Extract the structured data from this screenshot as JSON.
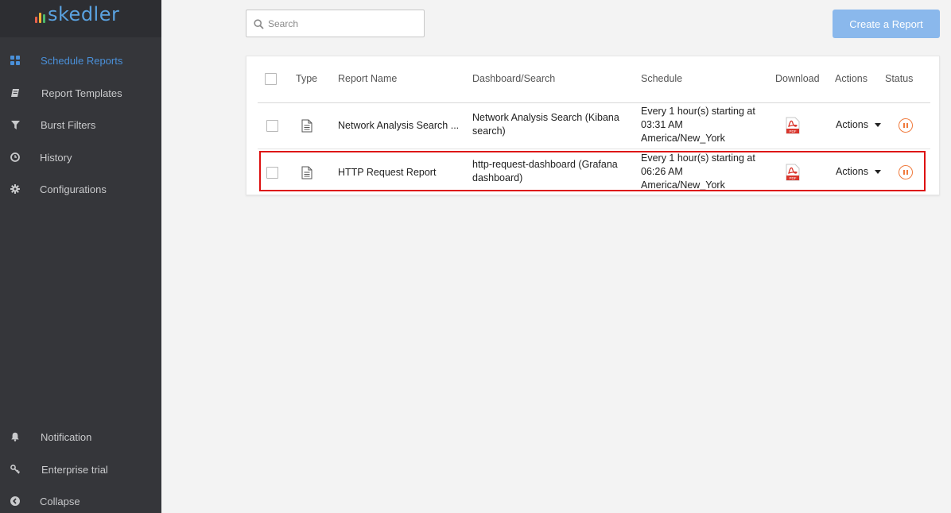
{
  "app": {
    "logo_text": "skedler",
    "logo_bar_colors": [
      "#e8604c",
      "#f2b233",
      "#4cb86b",
      "#4a90d9"
    ]
  },
  "sidebar": {
    "items": [
      {
        "label": "Schedule Reports",
        "icon": "grid-icon",
        "active": true
      },
      {
        "label": "Report Templates",
        "icon": "book-icon"
      },
      {
        "label": "Burst Filters",
        "icon": "filter-icon"
      },
      {
        "label": "History",
        "icon": "clock-icon"
      },
      {
        "label": "Configurations",
        "icon": "gear-icon"
      }
    ],
    "bottom_items": [
      {
        "label": "Notification",
        "icon": "bell-icon"
      },
      {
        "label": "Enterprise trial",
        "icon": "key-icon"
      },
      {
        "label": "Collapse",
        "icon": "chevron-left-circle-icon"
      }
    ]
  },
  "search": {
    "placeholder": "Search",
    "value": ""
  },
  "toolbar": {
    "create_label": "Create a Report"
  },
  "table": {
    "columns": [
      "Type",
      "Report Name",
      "Dashboard/Search",
      "Schedule",
      "Download",
      "Actions",
      "Status"
    ],
    "rows": [
      {
        "type_icon": "document-icon",
        "name": "Network Analysis Search ...",
        "dashboard": "Network Analysis Search (Kibana search)",
        "schedule": "Every 1 hour(s) starting at 03:31 AM America/New_York",
        "download_icon": "pdf-icon",
        "actions_label": "Actions",
        "status_icon": "pause-icon"
      },
      {
        "type_icon": "document-icon",
        "name": "HTTP Request Report",
        "dashboard": "http-request-dashboard (Grafana dashboard)",
        "schedule": "Every 1 hour(s) starting at 06:26 AM America/New_York",
        "download_icon": "pdf-icon",
        "actions_label": "Actions",
        "status_icon": "pause-icon",
        "highlighted": true
      }
    ]
  },
  "colors": {
    "sidebar_bg": "#35363a",
    "accent": "#4a90d9",
    "create_button": "#8ab8ec",
    "status_paused": "#f07a3c",
    "highlight": "#dd1111",
    "pdf": "#d9342b"
  }
}
